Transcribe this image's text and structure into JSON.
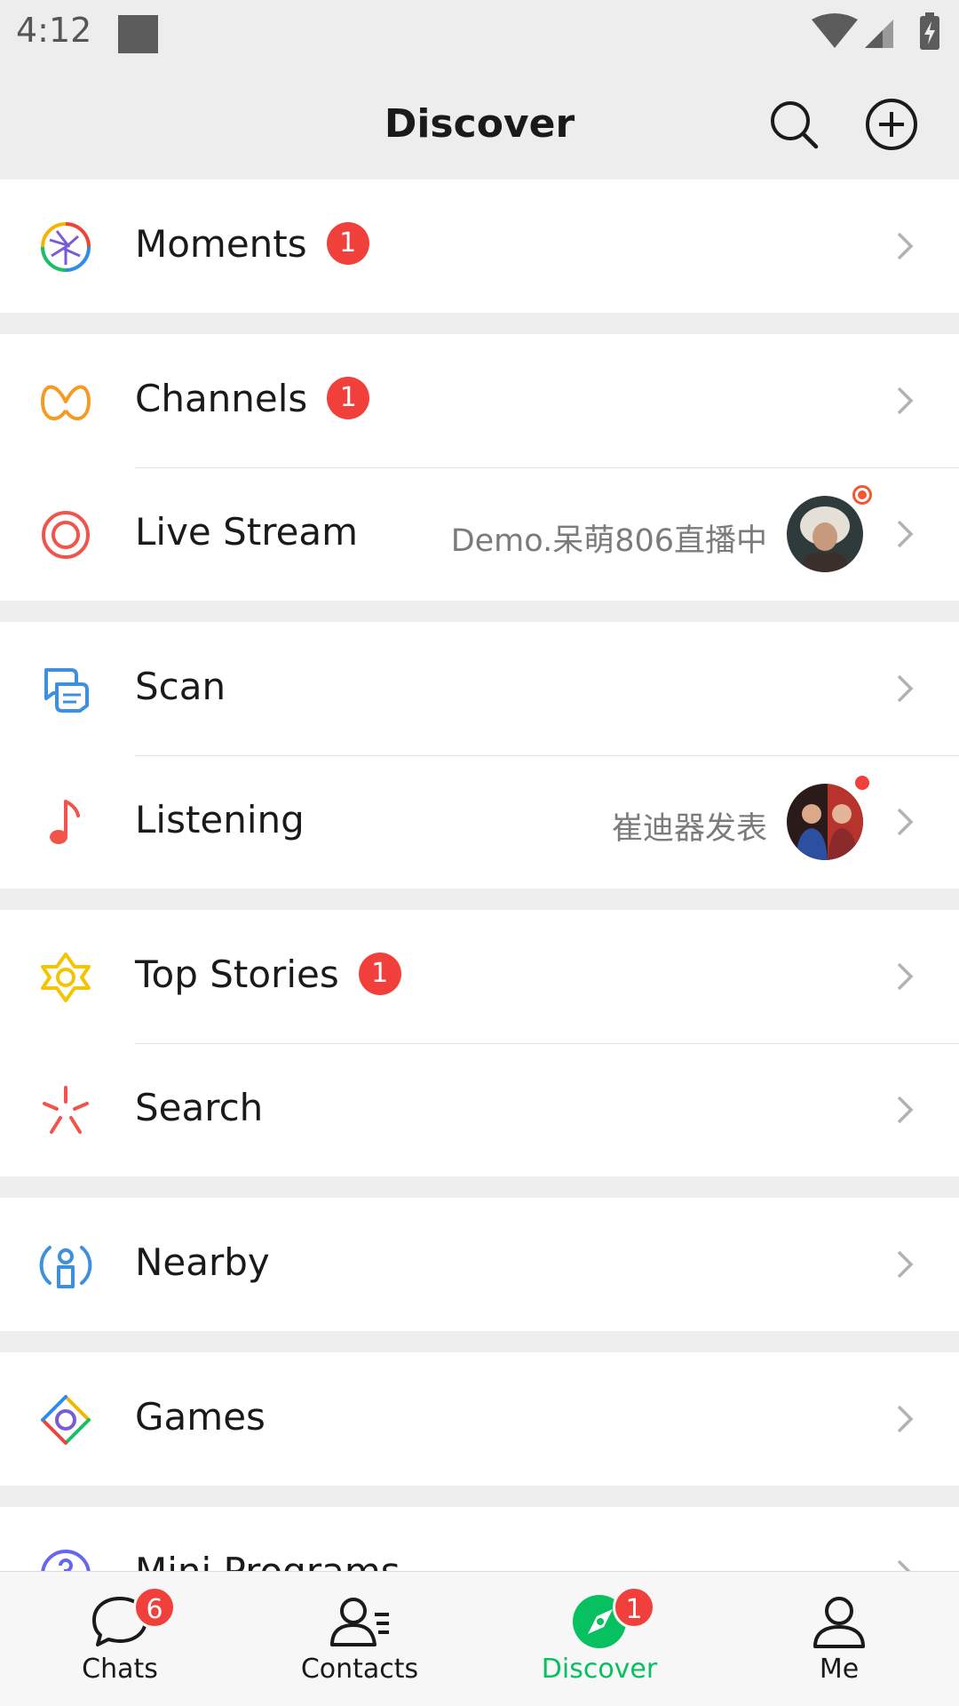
{
  "status": {
    "time": "4:12"
  },
  "header": {
    "title": "Discover"
  },
  "groups": [
    {
      "rows": [
        {
          "label": "Moments",
          "badge": "1",
          "icon": "moments-icon"
        }
      ]
    },
    {
      "rows": [
        {
          "label": "Channels",
          "badge": "1",
          "icon": "channels-icon"
        },
        {
          "label": "Live Stream",
          "right_text": "Demo.呆萌806直播中",
          "icon": "live-stream-icon"
        }
      ]
    },
    {
      "rows": [
        {
          "label": "Scan",
          "icon": "scan-icon"
        },
        {
          "label": "Listening",
          "right_text": "崔迪器发表",
          "icon": "music-note-icon"
        }
      ]
    },
    {
      "rows": [
        {
          "label": "Top Stories",
          "badge": "1",
          "icon": "top-stories-icon"
        },
        {
          "label": "Search",
          "icon": "search-sparkle-icon"
        }
      ]
    },
    {
      "rows": [
        {
          "label": "Nearby",
          "icon": "nearby-icon"
        }
      ]
    },
    {
      "rows": [
        {
          "label": "Games",
          "icon": "games-icon"
        }
      ]
    },
    {
      "rows": [
        {
          "label": "Mini Programs",
          "icon": "mini-programs-icon"
        }
      ]
    }
  ],
  "tabs": [
    {
      "label": "Chats",
      "badge": "6",
      "icon": "chat-bubble-icon"
    },
    {
      "label": "Contacts",
      "icon": "contacts-icon"
    },
    {
      "label": "Discover",
      "badge": "1",
      "icon": "compass-icon",
      "active": true
    },
    {
      "label": "Me",
      "icon": "person-icon"
    }
  ],
  "colors": {
    "accent": "#07c160",
    "badge": "#f1403c",
    "background": "#ededed"
  }
}
